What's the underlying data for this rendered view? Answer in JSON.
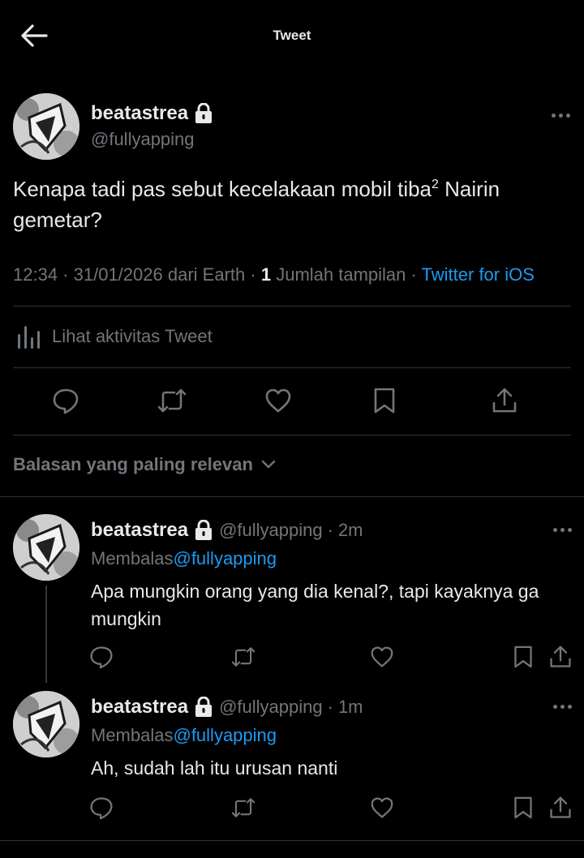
{
  "header": {
    "title": "Tweet",
    "back_icon": "arrow-left-icon"
  },
  "tweet": {
    "display_name": "beatastrea",
    "handle": "@fullyapping",
    "text_main": "Kenapa tadi pas sebut kecelakaan mobil tiba",
    "text_sup": "2",
    "text_rest": " Nairin gemetar?",
    "time": "12:34",
    "date": "31/01/2026",
    "origin_prefix": "dari",
    "origin": "Earth",
    "views_count": "1",
    "views_label": "Jumlah tampilan",
    "source": "Twitter for iOS",
    "activity_label": "Lihat aktivitas Tweet"
  },
  "actions": {
    "reply_icon": "reply-icon",
    "retweet_icon": "retweet-icon",
    "like_icon": "heart-icon",
    "bookmark_icon": "bookmark-icon",
    "share_icon": "share-icon"
  },
  "sort": {
    "label": "Balasan yang paling relevan"
  },
  "replies": [
    {
      "display_name": "beatastrea",
      "handle": "@fullyapping",
      "time": "2m",
      "replying_label": "Membalas",
      "replying_to": "@fullyapping",
      "text": "Apa mungkin orang yang dia kenal?, tapi kayaknya ga mungkin"
    },
    {
      "display_name": "beatastrea",
      "handle": "@fullyapping",
      "time": "1m",
      "replying_label": "Membalas",
      "replying_to": "@fullyapping",
      "text": "Ah, sudah lah itu urusan nanti"
    }
  ],
  "colors": {
    "background": "#000000",
    "text": "#e7e9ea",
    "muted": "#71767b",
    "accent": "#1d9bf0",
    "divider": "#2f3336"
  }
}
